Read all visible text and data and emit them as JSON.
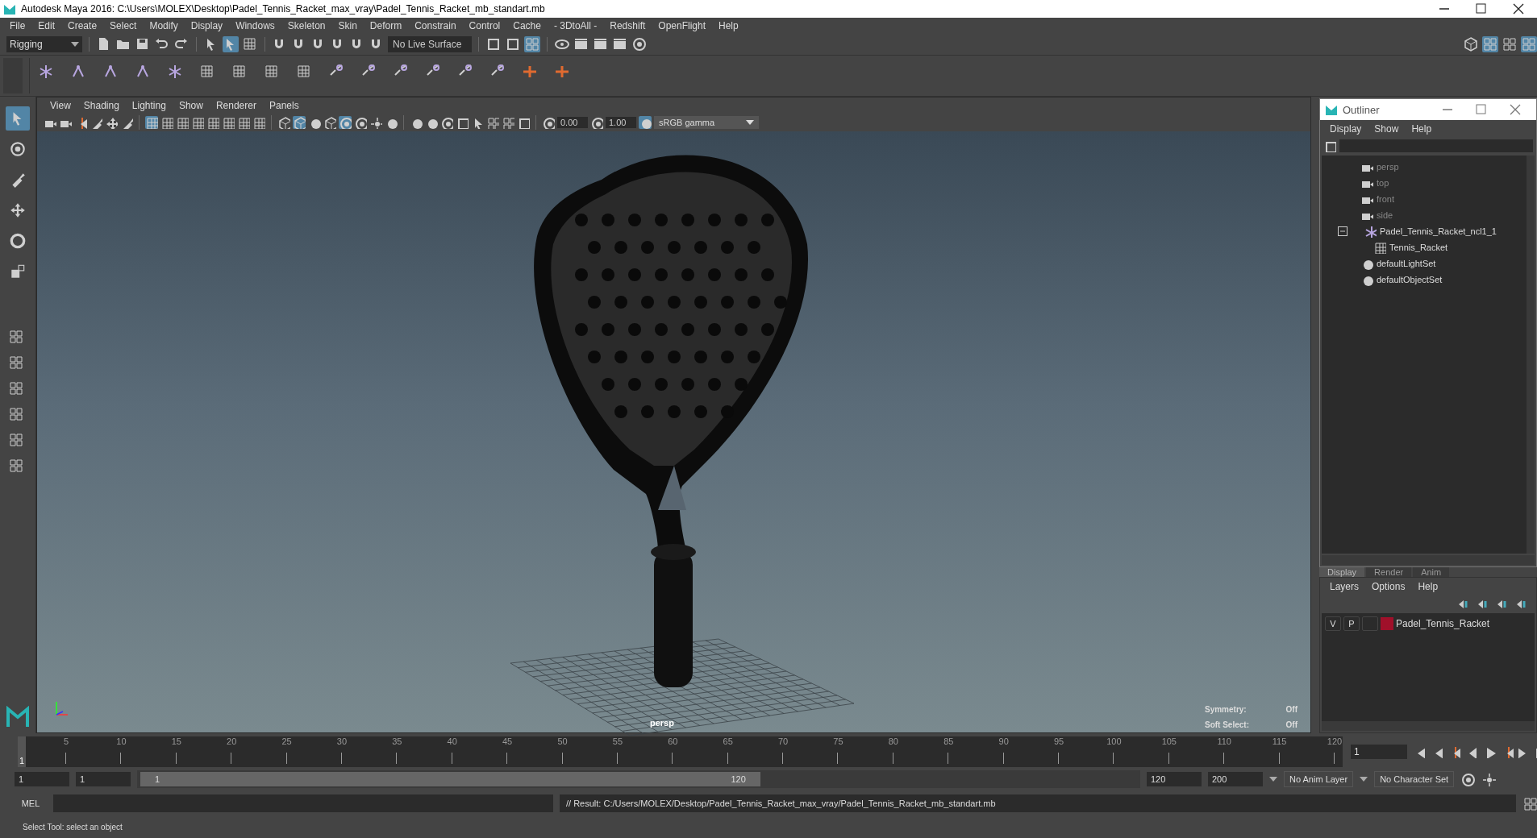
{
  "window": {
    "title": "Autodesk Maya 2016: C:\\Users\\MOLEX\\Desktop\\Padel_Tennis_Racket_max_vray\\Padel_Tennis_Racket_mb_standart.mb"
  },
  "menu_bar": [
    "File",
    "Edit",
    "Create",
    "Select",
    "Modify",
    "Display",
    "Windows",
    "Skeleton",
    "Skin",
    "Deform",
    "Constrain",
    "Control",
    "Cache",
    "- 3DtoAll -",
    "Redshift",
    "OpenFlight",
    "Help"
  ],
  "status_line": {
    "menu_set": "Rigging",
    "live_surface": "No Live Surface"
  },
  "toolbox": [
    {
      "selected": true
    },
    {
      "selected": false
    },
    {
      "selected": false
    },
    {
      "selected": false
    },
    {
      "selected": false
    },
    {
      "selected": false
    }
  ],
  "panel_menu": [
    "View",
    "Shading",
    "Lighting",
    "Show",
    "Renderer",
    "Panels"
  ],
  "panel_toolbar": {
    "near": "0.00",
    "far": "1.00",
    "color_space": "sRGB gamma"
  },
  "viewport": {
    "camera": "persp",
    "hud": [
      {
        "label": "Symmetry:",
        "value": "Off"
      },
      {
        "label": "Soft Select:",
        "value": "Off"
      }
    ]
  },
  "outliner": {
    "title": "Outliner",
    "menu": [
      "Display",
      "Show",
      "Help"
    ],
    "items": [
      {
        "label": "persp",
        "kind": "camera",
        "dimmed": true
      },
      {
        "label": "top",
        "kind": "camera",
        "dimmed": true
      },
      {
        "label": "front",
        "kind": "camera",
        "dimmed": true
      },
      {
        "label": "side",
        "kind": "camera",
        "dimmed": true
      },
      {
        "label": "Padel_Tennis_Racket_ncl1_1",
        "kind": "group",
        "dimmed": false,
        "expanded": true,
        "children": [
          {
            "label": "Tennis_Racket",
            "kind": "mesh",
            "dimmed": false
          }
        ]
      },
      {
        "label": "defaultLightSet",
        "kind": "set",
        "dimmed": false
      },
      {
        "label": "defaultObjectSet",
        "kind": "set",
        "dimmed": false
      }
    ]
  },
  "layer_editor": {
    "tabs": [
      {
        "label": "Display",
        "selected": true
      },
      {
        "label": "Render",
        "selected": false
      },
      {
        "label": "Anim",
        "selected": false
      }
    ],
    "menu": [
      "Layers",
      "Options",
      "Help"
    ],
    "layers": [
      {
        "visibility": "V",
        "playback": "P",
        "name": "Padel_Tennis_Racket",
        "color": "#a0102a"
      }
    ]
  },
  "time_slider": {
    "current": "1",
    "level": 0,
    "ticks": [
      "5",
      "10",
      "15",
      "20",
      "25",
      "30",
      "35",
      "40",
      "45",
      "50",
      "55",
      "60",
      "65",
      "70",
      "75",
      "80",
      "85",
      "90",
      "95",
      "100",
      "105",
      "110",
      "115",
      "120"
    ],
    "frame_field": "1"
  },
  "range_slider": {
    "level": 0.62,
    "start": "1",
    "range_start_field": "1",
    "range_start": "1",
    "range_end": "120",
    "end": "120",
    "max": "200",
    "anim_layer": "No Anim Layer",
    "character_set": "No Character Set"
  },
  "command_line": {
    "language": "MEL",
    "result": "// Result: C:/Users/MOLEX/Desktop/Padel_Tennis_Racket_max_vray/Padel_Tennis_Racket_mb_standart.mb"
  },
  "help_line": "Select Tool: select an object"
}
